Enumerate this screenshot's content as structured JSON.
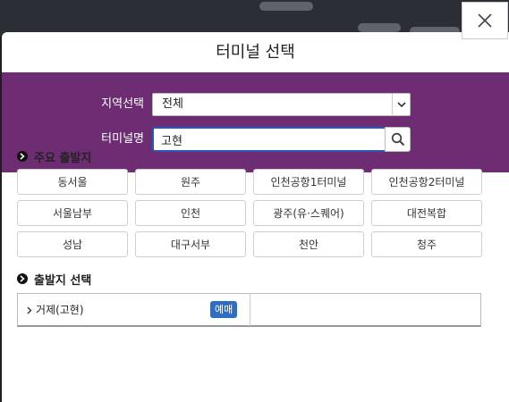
{
  "dialog": {
    "title": "터미널 선택",
    "close_icon": "close-icon"
  },
  "search": {
    "region_label": "지역선택",
    "region_value": "전체",
    "terminal_label": "터미널명",
    "terminal_value": "고현"
  },
  "major_departures": {
    "heading": "주요 출발지",
    "items": [
      {
        "label": "동서울"
      },
      {
        "label": "원주"
      },
      {
        "label": "인천공항1터미널"
      },
      {
        "label": "인천공항2터미널"
      },
      {
        "label": "서울남부"
      },
      {
        "label": "인천"
      },
      {
        "label": "광주(유·스퀘어)"
      },
      {
        "label": "대전복합"
      },
      {
        "label": "성남"
      },
      {
        "label": "대구서부"
      },
      {
        "label": "천안"
      },
      {
        "label": "청주"
      }
    ]
  },
  "departure_select": {
    "heading": "출발지 선택",
    "results": [
      {
        "label": "거제(고현)",
        "badge": "예매"
      }
    ]
  },
  "colors": {
    "panel": "#6e2d73",
    "badge": "#2d6ec4",
    "input_focus": "#2a57b8"
  }
}
